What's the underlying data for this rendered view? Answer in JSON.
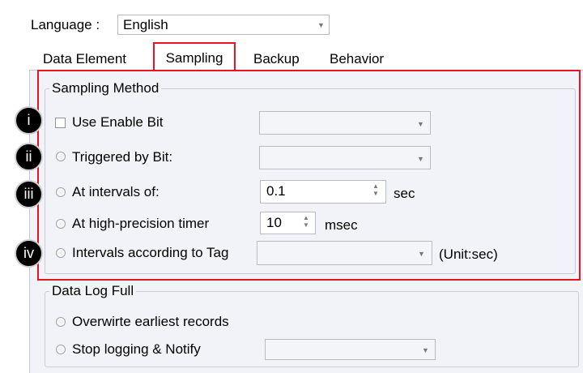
{
  "language": {
    "label": "Language :",
    "value": "English"
  },
  "tabs": [
    "Data Element",
    "Sampling",
    "Backup",
    "Behavior"
  ],
  "sampling_method": {
    "legend": "Sampling Method",
    "use_enable_bit": "Use Enable Bit",
    "triggered_by_bit": "Triggered by Bit:",
    "at_intervals": {
      "label": "At intervals of:",
      "value": "0.1",
      "unit": "sec"
    },
    "high_precision": {
      "label": "At high-precision timer",
      "value": "10",
      "unit": "msec"
    },
    "intervals_tag": {
      "label": "Intervals according to Tag",
      "unit": "(Unit:sec)"
    }
  },
  "data_log_full": {
    "legend": "Data Log Full",
    "overwrite": "Overwirte earliest records",
    "stop": "Stop logging & Notify"
  },
  "badges": [
    "i",
    "ii",
    "iii",
    "iv"
  ],
  "colors": {
    "highlight": "#e8141f",
    "panel": "#f1f3f9"
  }
}
